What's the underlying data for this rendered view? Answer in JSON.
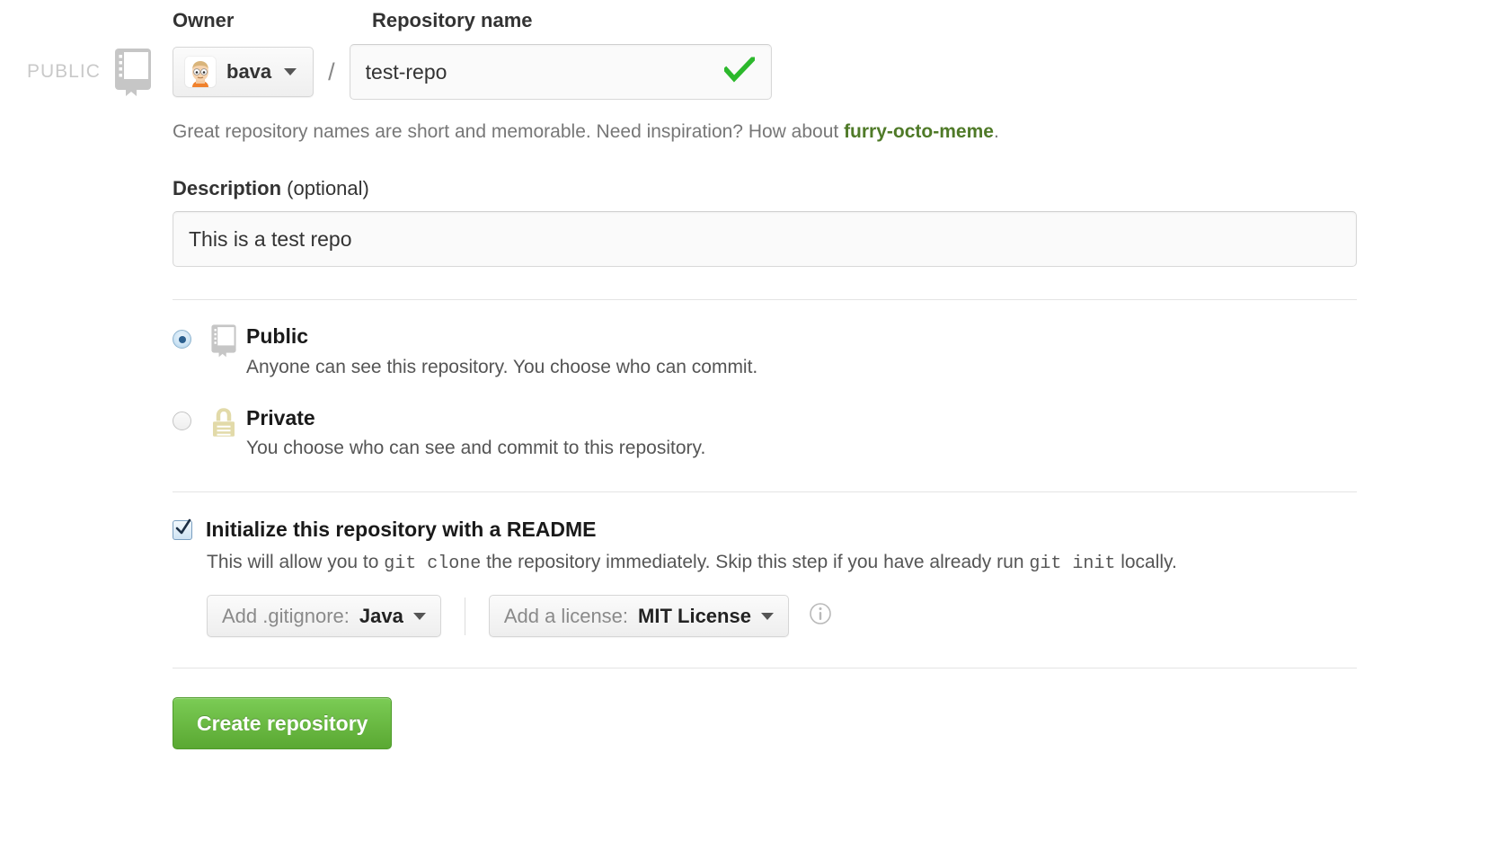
{
  "visibility_badge": {
    "label": "PUBLIC",
    "icon": "repo-book-icon"
  },
  "owner_field": {
    "label": "Owner",
    "selected_owner": "bava",
    "avatar_alt": "bava-avatar"
  },
  "separator": "/",
  "repo_name_field": {
    "label": "Repository name",
    "value": "test-repo",
    "placeholder": "",
    "valid_icon": "green-check-icon"
  },
  "hint": {
    "text_before": "Great repository names are short and memorable. Need inspiration? How about ",
    "suggestion": "furry-octo-meme",
    "text_after": "."
  },
  "description_field": {
    "label_bold": "Description",
    "label_optional": " (optional)",
    "value": "This is a test repo",
    "placeholder": ""
  },
  "visibility_options": [
    {
      "id": "public",
      "title": "Public",
      "description": "Anyone can see this repository. You choose who can commit.",
      "selected": true,
      "icon": "repo-book-icon"
    },
    {
      "id": "private",
      "title": "Private",
      "description": "You choose who can see and commit to this repository.",
      "selected": false,
      "icon": "lock-icon"
    }
  ],
  "readme": {
    "checked": true,
    "title": "Initialize this repository with a README",
    "desc_part1": "This will allow you to ",
    "desc_code1": "git clone",
    "desc_part2": " the repository immediately. Skip this step if you have already run ",
    "desc_code2": "git init",
    "desc_part3": " locally."
  },
  "gitignore_dropdown": {
    "prefix": "Add .gitignore:",
    "value": "Java",
    "caret_icon": "chevron-down-icon"
  },
  "license_dropdown": {
    "prefix": "Add a license:",
    "value": "MIT License",
    "caret_icon": "chevron-down-icon"
  },
  "info_icon_name": "info-icon",
  "submit": {
    "label": "Create repository"
  },
  "colors": {
    "accent_green_button": "#6cc644",
    "suggestion_green": "#4f7a28",
    "check_green": "#2cb82c",
    "badge_gray": "#c9c9c9",
    "lock_tan": "#e2daa9",
    "repo_icon_gray": "#c6c6c6",
    "radio_blue": "#2a5f8f"
  }
}
